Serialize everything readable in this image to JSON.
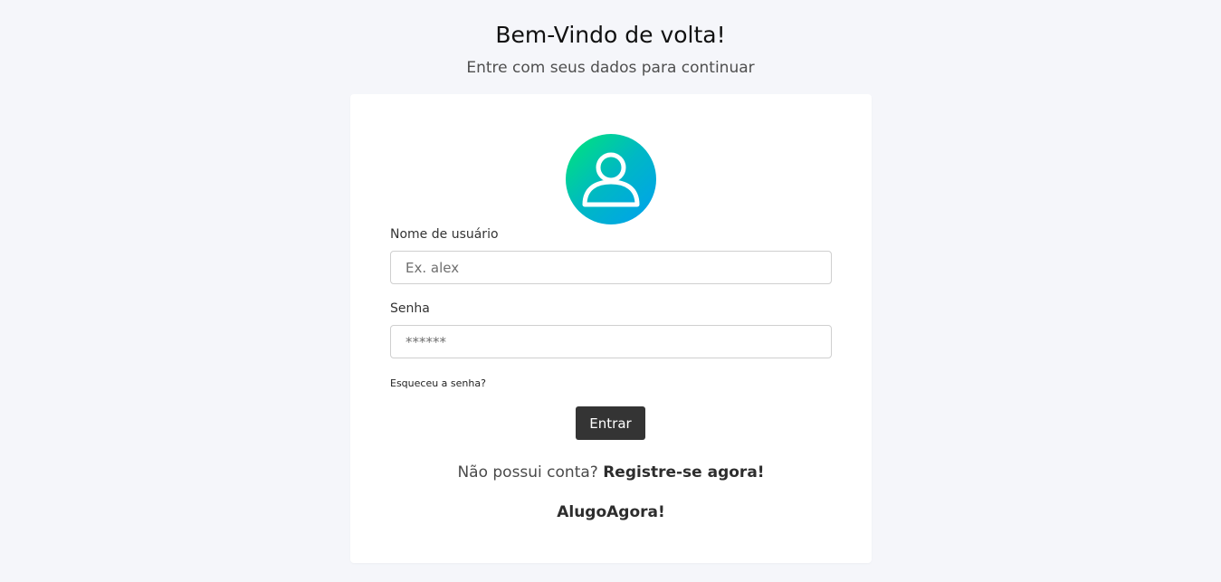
{
  "header": {
    "title": "Bem-Vindo de volta!",
    "subtitle": "Entre com seus dados para continuar"
  },
  "avatar": {
    "icon": "user-icon",
    "gradient_colors": [
      "#00e676",
      "#00a0f0"
    ]
  },
  "form": {
    "username_label": "Nome de usuário",
    "username_placeholder": "Ex. alex",
    "username_value": "",
    "password_label": "Senha",
    "password_placeholder": "******",
    "password_value": "",
    "forgot_link": "Esqueceu a senha?",
    "submit_label": "Entrar"
  },
  "register": {
    "prompt": "Não possui conta?",
    "link": "Registre-se agora!"
  },
  "brand": {
    "name": "AlugoAgora!"
  },
  "colors": {
    "background": "#f5f6fa",
    "card": "#ffffff",
    "button": "#343434"
  }
}
